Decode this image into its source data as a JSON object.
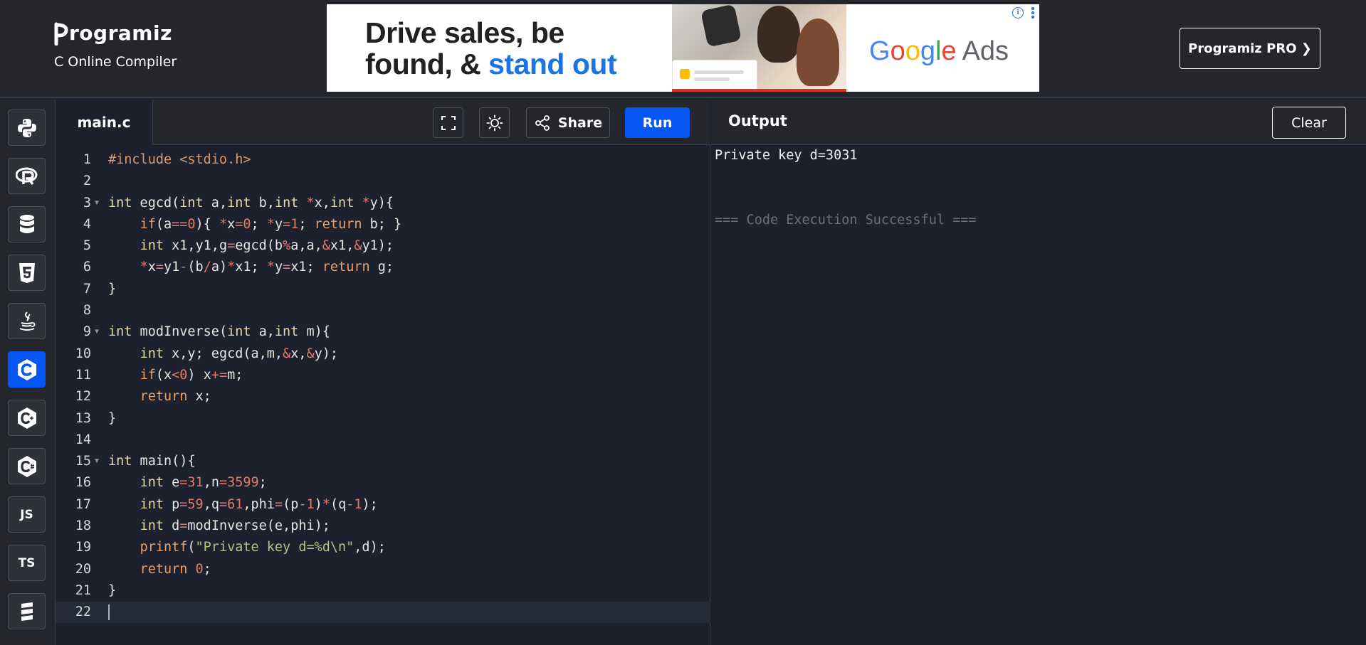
{
  "header": {
    "logo_text": "rogramiz",
    "subtitle": "C Online Compiler",
    "pro_button": "Programiz PRO ❯"
  },
  "ad": {
    "headline_line1": "Drive sales, be",
    "headline_line2_plain": "found, & ",
    "headline_line2_blue": "stand out",
    "brand_letters": [
      "G",
      "o",
      "o",
      "g",
      "l",
      "e"
    ],
    "brand_suffix": "Ads",
    "info_icon": "i"
  },
  "sidebar": {
    "languages": [
      {
        "name": "python",
        "icon": "python-icon"
      },
      {
        "name": "r",
        "icon": "r-icon"
      },
      {
        "name": "sql",
        "icon": "database-icon"
      },
      {
        "name": "html",
        "icon": "html5-icon"
      },
      {
        "name": "java",
        "icon": "java-icon"
      },
      {
        "name": "c",
        "icon": "c-icon",
        "active": true
      },
      {
        "name": "cpp",
        "icon": "cpp-icon"
      },
      {
        "name": "csharp",
        "icon": "csharp-icon"
      },
      {
        "name": "javascript",
        "label": "JS"
      },
      {
        "name": "typescript",
        "label": "TS"
      },
      {
        "name": "swift",
        "icon": "stack-icon"
      }
    ]
  },
  "editor": {
    "file_tab": "main.c",
    "share_label": "Share",
    "run_label": "Run",
    "line_numbers": [
      "1",
      "2",
      "3",
      "4",
      "5",
      "6",
      "7",
      "8",
      "9",
      "10",
      "11",
      "12",
      "13",
      "14",
      "15",
      "16",
      "17",
      "18",
      "19",
      "20",
      "21",
      "22"
    ],
    "code_lines": [
      "#include <stdio.h>",
      "",
      "int egcd(int a,int b,int *x,int *y){",
      "    if(a==0){ *x=0; *y=1; return b; }",
      "    int x1,y1,g=egcd(b%a,a,&x1,&y1);",
      "    *x=y1-(b/a)*x1; *y=x1; return g;",
      "}",
      "",
      "int modInverse(int a,int m){",
      "    int x,y; egcd(a,m,&x,&y);",
      "    if(x<0) x+=m;",
      "    return x;",
      "}",
      "",
      "int main(){",
      "    int e=31,n=3599;",
      "    int p=59,q=61,phi=(p-1)*(q-1);",
      "    int d=modInverse(e,phi);",
      "    printf(\"Private key d=%d\\n\",d);",
      "    return 0;",
      "}",
      ""
    ]
  },
  "output": {
    "title": "Output",
    "clear_label": "Clear",
    "result_line": "Private key d=3031",
    "status_line": "=== Code Execution Successful ==="
  },
  "colors": {
    "run_button": "#0556f3",
    "background": "#1c212d",
    "header": "#24262b"
  }
}
